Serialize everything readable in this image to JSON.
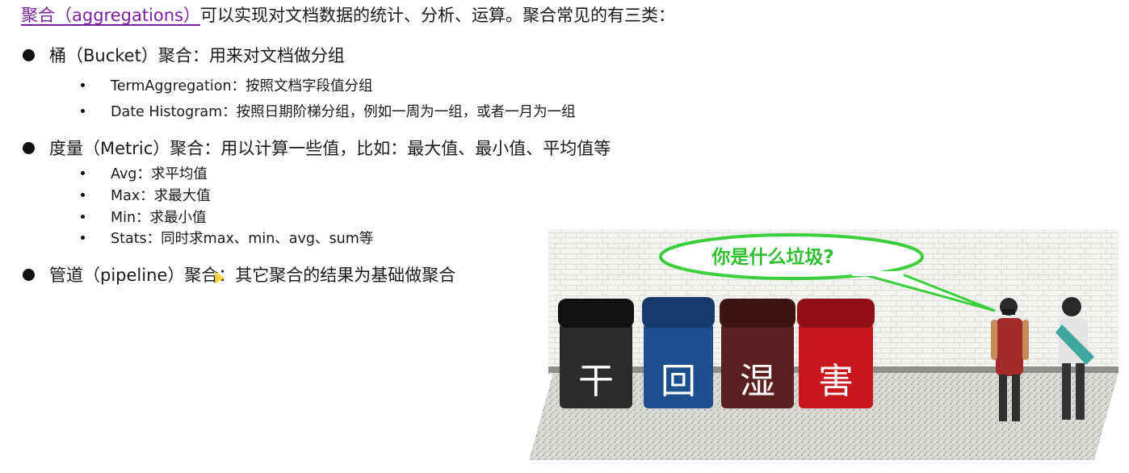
{
  "intro": {
    "term": "聚合（aggregations）",
    "rest": "可以实现对文档数据的统计、分析、运算。聚合常见的有三类："
  },
  "sections": [
    {
      "label": "桶（Bucket）聚合：用来对文档做分组",
      "items": [
        "TermAggregation：按照文档字段值分组",
        "Date Histogram：按照日期阶梯分组，例如一周为一组，或者一月为一组"
      ]
    },
    {
      "label": "度量（Metric）聚合：用以计算一些值，比如：最大值、最小值、平均值等",
      "items": [
        "Avg：求平均值",
        "Max：求最大值",
        "Min：求最小值",
        "Stats：同时求max、min、avg、sum等"
      ]
    },
    {
      "label": "管道（pipeline）聚合：其它聚合的结果为基础做聚合",
      "items": []
    }
  ],
  "illustration": {
    "speech": "你是什么垃圾?",
    "bins": [
      {
        "char": "干",
        "color": "#2b2b2b",
        "lid": "#111111"
      },
      {
        "char": "回",
        "color": "#1d4f8f",
        "lid": "#153a6b"
      },
      {
        "char": "湿",
        "color": "#5b1f1f",
        "lid": "#3d1414"
      },
      {
        "char": "害",
        "color": "#c8161d",
        "lid": "#8f0f14"
      }
    ],
    "speech_color": "#3ccf3c"
  }
}
